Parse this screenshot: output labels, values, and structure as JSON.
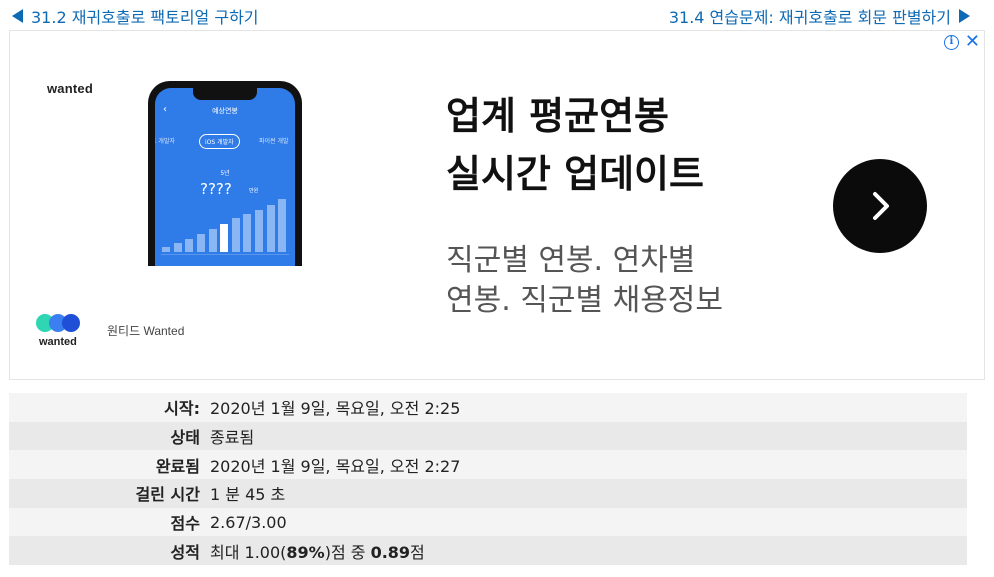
{
  "nav": {
    "prev_label": "31.2 재귀호출로 팩토리얼 구하기",
    "next_label": "31.4 연습문제: 재귀호출로 회문 판별하기"
  },
  "ad": {
    "brand_logo_text": "wanted",
    "phone": {
      "title": "예상연봉",
      "tabs": [
        "드 개발자",
        "iOS 개발자",
        "파이썬 개발"
      ],
      "year_label": "5년",
      "value": "????",
      "unit": "만원",
      "bar_levels": [
        0.08,
        0.15,
        0.22,
        0.3,
        0.38,
        0.47,
        0.56,
        0.63,
        0.7,
        0.78,
        0.88
      ],
      "highlight_index": 5,
      "accent_color": "#2f7be8"
    },
    "headline": [
      "업계 평균연봉",
      "실시간 업데이트"
    ],
    "subtext": [
      "직군별 연봉. 연차별",
      "연봉. 직군별 채용정보"
    ],
    "cta_icon": "chevron-right-icon",
    "brand_colors": [
      "#2fd6b4",
      "#3c7ff0",
      "#1f4fd6"
    ],
    "brand_name": "wanted",
    "advertiser_name": "원티드 Wanted"
  },
  "summary": {
    "rows": [
      {
        "label": "시작:",
        "value": "2020년 1월 9일, 목요일, 오전 2:25"
      },
      {
        "label": "상태",
        "value": "종료됨"
      },
      {
        "label": "완료됨",
        "value": "2020년 1월 9일, 목요일, 오전 2:27"
      },
      {
        "label": "걸린 시간",
        "value": "1 분 45 초"
      },
      {
        "label": "점수",
        "value": "2.67/3.00"
      }
    ],
    "grade": {
      "label": "성적",
      "prefix": "최대 1.00(",
      "percent": "89%",
      "middle": ")점 중 ",
      "score": "0.89",
      "suffix": "점"
    }
  }
}
